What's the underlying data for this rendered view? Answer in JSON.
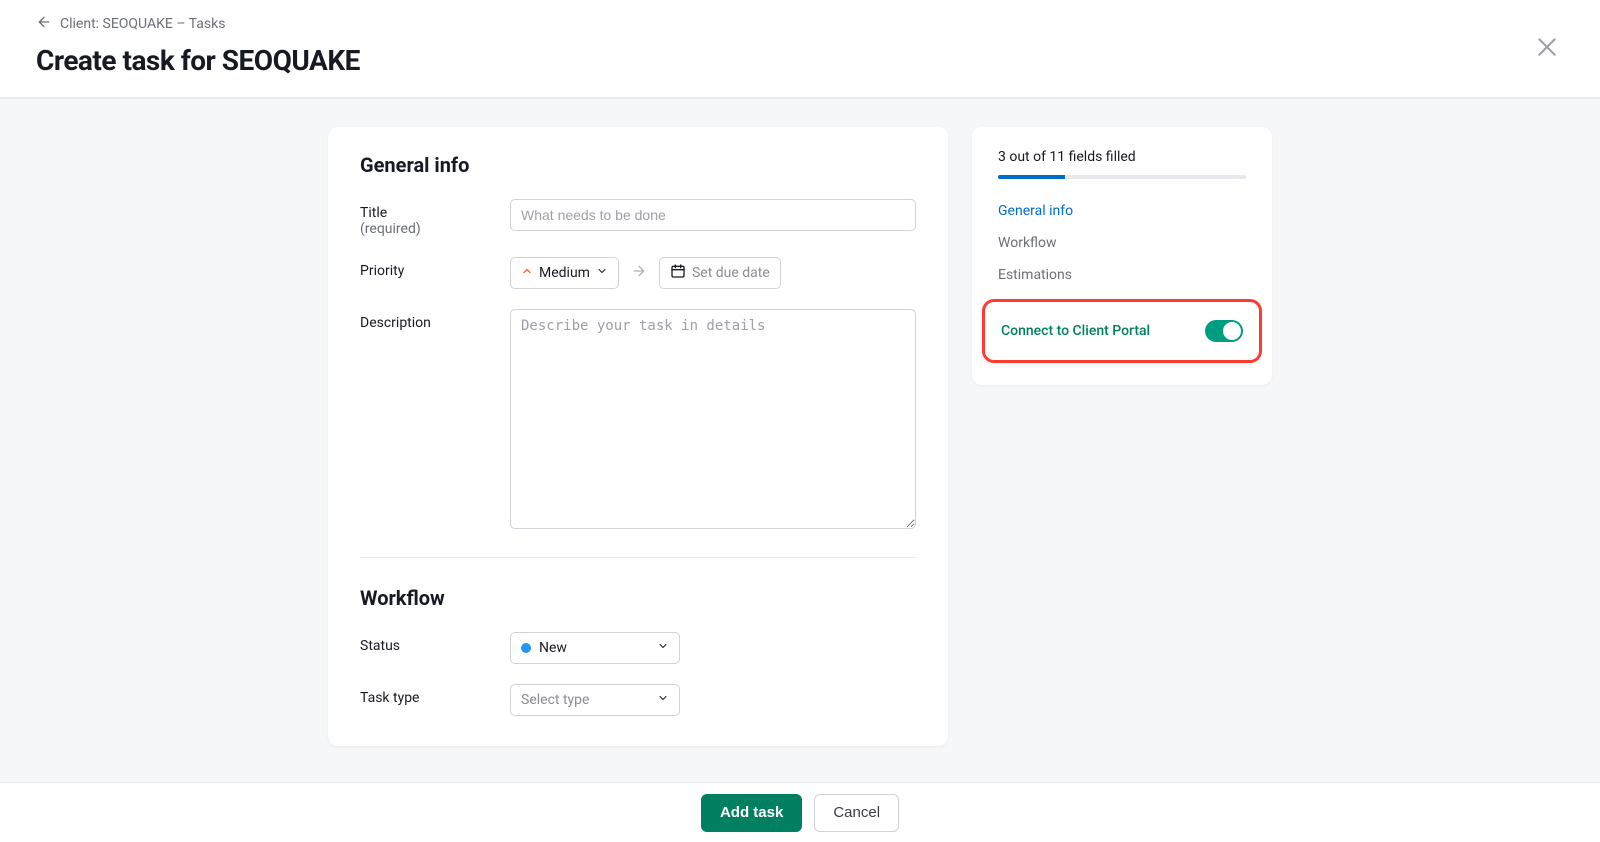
{
  "breadcrumb": "Client: SEOQUAKE – Tasks",
  "page_title": "Create task for SEOQUAKE",
  "sections": {
    "general": {
      "title": "General info",
      "title_label": "Title",
      "title_required": "(required)",
      "title_placeholder": "What needs to be done",
      "priority_label": "Priority",
      "priority_value": "Medium",
      "due_date_placeholder": "Set due date",
      "description_label": "Description",
      "description_placeholder": "Describe your task in details"
    },
    "workflow": {
      "title": "Workflow",
      "status_label": "Status",
      "status_value": "New",
      "task_type_label": "Task type",
      "task_type_placeholder": "Select type"
    }
  },
  "side": {
    "progress_text": "3 out of 11 fields filled",
    "nav": {
      "general": "General info",
      "workflow": "Workflow",
      "estimations": "Estimations"
    },
    "connect_label": "Connect to Client Portal"
  },
  "footer": {
    "primary": "Add task",
    "secondary": "Cancel"
  }
}
